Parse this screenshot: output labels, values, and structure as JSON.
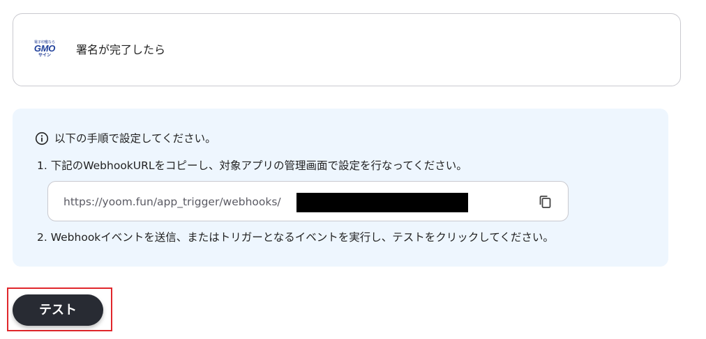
{
  "trigger": {
    "logo": {
      "tagline": "電子印鑑なら",
      "brand": "GMO",
      "sub": "サイン"
    },
    "title": "署名が完了したら"
  },
  "instructions": {
    "title": "以下の手順で設定してください。",
    "step1": "1. 下記のWebhookURLをコピーし、対象アプリの管理画面で設定を行なってください。",
    "url": "https://yoom.fun/app_trigger/webhooks/",
    "step2": "2. Webhookイベントを送信、またはトリガーとなるイベントを実行し、テストをクリックしてください。"
  },
  "actions": {
    "test_label": "テスト"
  },
  "colors": {
    "panel_bg": "#eef6fe",
    "button_bg": "#282b33",
    "highlight": "#e0262b",
    "brand": "#1f3f9a"
  },
  "icons": {
    "info": "info-circle-icon",
    "copy": "copy-icon"
  }
}
